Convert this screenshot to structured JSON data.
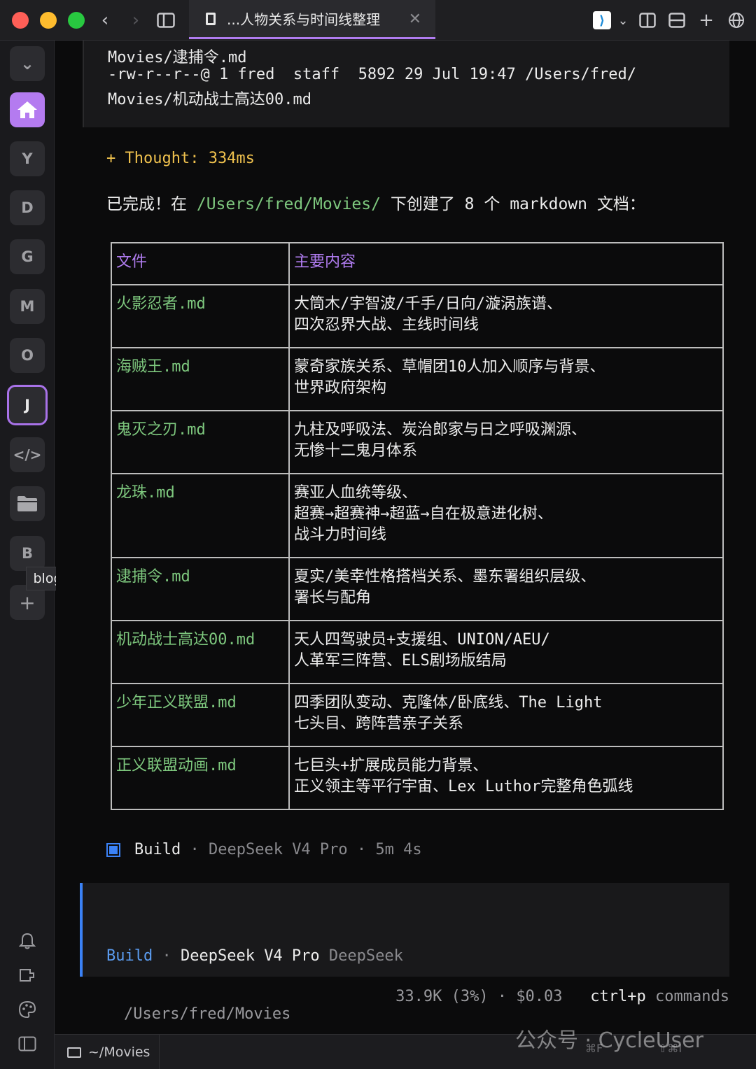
{
  "window": {
    "tab_title": "...人物关系与时间线整理",
    "tab_close": "✕"
  },
  "sidebar": {
    "items": [
      {
        "label": "⌄"
      },
      {
        "label": "⌂"
      },
      {
        "label": "Y"
      },
      {
        "label": "D"
      },
      {
        "label": "G"
      },
      {
        "label": "M"
      },
      {
        "label": "O"
      },
      {
        "label": "J"
      },
      {
        "label": "</>"
      },
      {
        "label": "▬"
      },
      {
        "label": "B"
      }
    ],
    "tooltip": "blog",
    "add": "+"
  },
  "terminal": {
    "code_lines": [
      "Movies/逮捕令.md",
      "-rw-r--r--@ 1 fred  staff  5892 29 Jul 19:47 /Users/fred/",
      "Movies/机动战士高达00.md"
    ],
    "thought": "+ Thought: 334ms",
    "done_prefix": "已完成！在 ",
    "done_path": "/Users/fred/Movies/",
    "done_suffix": " 下创建了 8 个 markdown 文档：",
    "table": {
      "headers": [
        "文件",
        "主要内容"
      ],
      "rows": [
        {
          "file": "火影忍者.md",
          "content": "大筒木/宇智波/千手/日向/漩涡族谱、\n四次忍界大战、主线时间线"
        },
        {
          "file": "海贼王.md",
          "content": "蒙奇家族关系、草帽团10人加入顺序与背景、\n世界政府架构"
        },
        {
          "file": "鬼灭之刃.md",
          "content": "九柱及呼吸法、炭治郎家与日之呼吸渊源、\n无惨十二鬼月体系"
        },
        {
          "file": "龙珠.md",
          "content": "赛亚人血统等级、\n超赛→超赛神→超蓝→自在极意进化树、\n战斗力时间线"
        },
        {
          "file": "逮捕令.md",
          "content": "夏实/美幸性格搭档关系、墨东署组织层级、\n署长与配角"
        },
        {
          "file": "机动战士高达00.md",
          "content": "天人四驾驶员+支援组、UNION/AEU/\n人革军三阵营、ELS剧场版结局"
        },
        {
          "file": "少年正义联盟.md",
          "content": "四季团队变动、克隆体/卧底线、The Light\n七头目、跨阵营亲子关系"
        },
        {
          "file": "正义联盟动画.md",
          "content": "七巨头+扩展成员能力背景、\n正义领主等平行宇宙、Lex Luthor完整角色弧线"
        }
      ]
    },
    "build": {
      "label": "Build",
      "sep": " · ",
      "model": "DeepSeek V4 Pro",
      "duration": "5m 4s"
    },
    "input": {
      "agent": "Build",
      "sep": " · ",
      "model": "DeepSeek V4 Pro",
      "provider": "DeepSeek"
    },
    "status": {
      "cwd": "/Users/fred/Movies",
      "tokens": "33.9K (3%)",
      "sep": " · ",
      "cost": "$0.03",
      "shortcut": "ctrl+p",
      "shortcut_label": " commands"
    }
  },
  "bottombar": {
    "dir": "~/Movies",
    "shortcut1": "⌘F",
    "shortcut2": "⇧⌘I"
  },
  "watermark": "公众号 · CycleUser"
}
